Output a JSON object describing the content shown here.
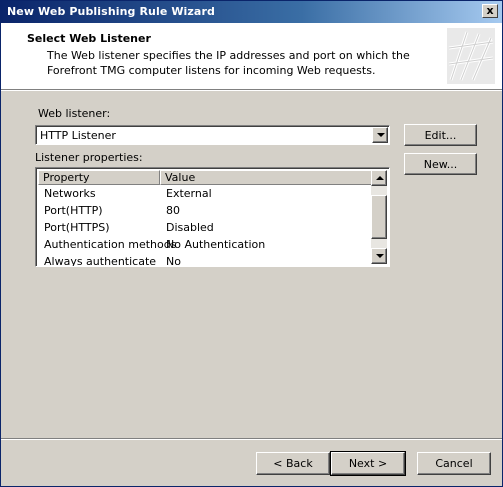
{
  "window": {
    "title": "New Web Publishing Rule Wizard",
    "close_glyph": "x"
  },
  "header": {
    "title": "Select Web Listener",
    "description": "The Web listener specifies the IP addresses and port on which the Forefront TMG computer listens for incoming Web requests."
  },
  "listener": {
    "label": "Web listener:",
    "selected": "HTTP Listener",
    "edit_label": "Edit...",
    "new_label": "New..."
  },
  "properties": {
    "label": "Listener properties:",
    "columns": [
      "Property",
      "Value"
    ],
    "rows": [
      {
        "property": "Networks",
        "value": "External"
      },
      {
        "property": "Port(HTTP)",
        "value": "80"
      },
      {
        "property": "Port(HTTPS)",
        "value": "Disabled"
      },
      {
        "property": "Authentication methods",
        "value": "No Authentication"
      },
      {
        "property": "Always authenticate",
        "value": "No"
      }
    ]
  },
  "footer": {
    "back_label": "< Back",
    "next_label": "Next >",
    "cancel_label": "Cancel"
  },
  "colors": {
    "dialog": "#d4d0c8",
    "title_start": "#0a246a",
    "title_end": "#a6caf0"
  }
}
